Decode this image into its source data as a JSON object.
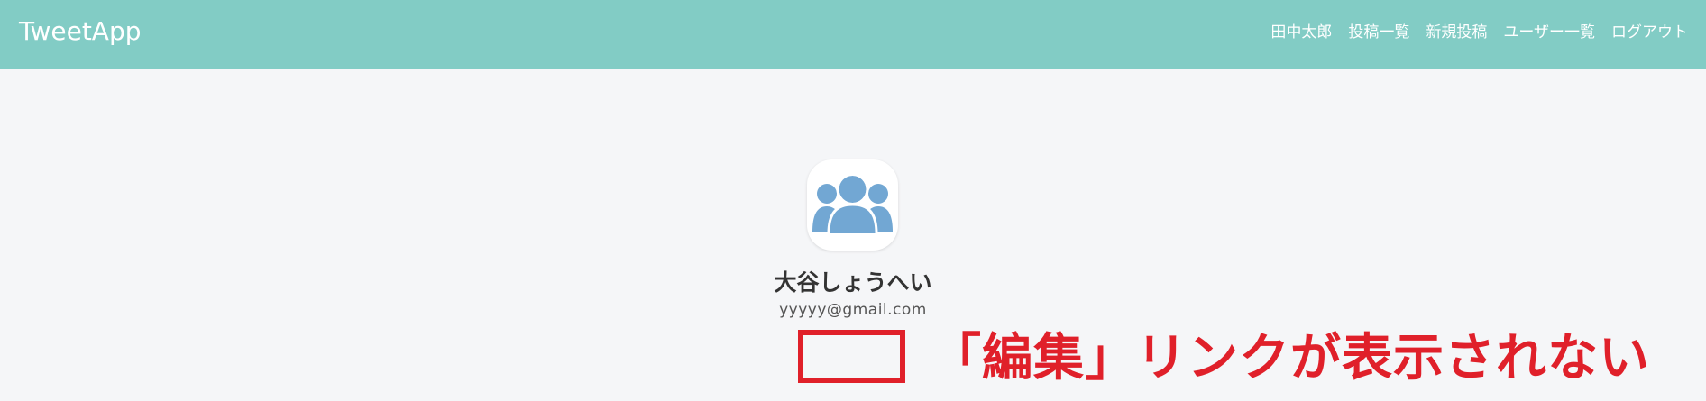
{
  "header": {
    "brand": "TweetApp",
    "nav": [
      {
        "label": "田中太郎"
      },
      {
        "label": "投稿一覧"
      },
      {
        "label": "新規投稿"
      },
      {
        "label": "ユーザー一覧"
      },
      {
        "label": "ログアウト"
      }
    ]
  },
  "profile": {
    "avatar_icon": "users-group-icon",
    "name": "大谷しょうへい",
    "email": "yyyyy@gmail.com"
  },
  "annotation": {
    "text": "「編集」リンクが表示されない",
    "color": "#e0202a"
  },
  "colors": {
    "header_bg": "#82ccc5",
    "page_bg": "#f5f6f8",
    "avatar_fill": "#72a7d3",
    "annotation_red": "#e0202a"
  }
}
